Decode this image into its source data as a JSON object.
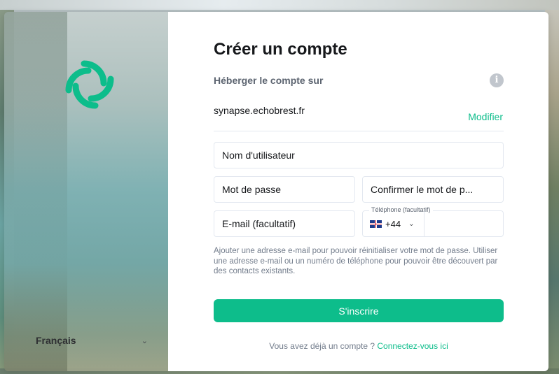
{
  "colors": {
    "accent": "#0dbd8b",
    "text_primary": "#17191c",
    "text_secondary": "#737d8c",
    "border": "#e3e8f0"
  },
  "sidebar": {
    "logo_icon": "element-logo-icon",
    "language": "Français"
  },
  "form": {
    "title": "Créer un compte",
    "host_label": "Héberger le compte sur",
    "info_icon": "info-icon",
    "server": "synapse.echobrest.fr",
    "modify_label": "Modifier",
    "username_placeholder": "Nom d'utilisateur",
    "password_placeholder": "Mot de passe",
    "confirm_placeholder": "Confirmer le mot de p...",
    "email_placeholder": "E-mail (facultatif)",
    "phone_label": "Téléphone (facultatif)",
    "phone_country_code": "+44",
    "phone_flag_icon": "uk-flag-icon",
    "hint": "Ajouter une adresse e-mail pour pouvoir réinitialiser votre mot de passe. Utiliser une adresse e-mail ou un numéro de téléphone pour pouvoir être découvert par des contacts existants.",
    "submit_label": "S'inscrire",
    "login_prompt": "Vous avez déjà un compte ? ",
    "login_link": "Connectez-vous ici"
  }
}
